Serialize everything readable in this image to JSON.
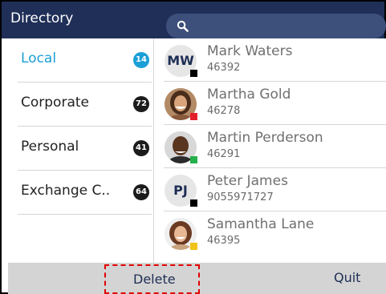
{
  "header": {
    "title": "Directory"
  },
  "search": {
    "icon": "search-icon",
    "value": ""
  },
  "sidebar": {
    "items": [
      {
        "label": "Local",
        "count": "14",
        "active": true
      },
      {
        "label": "Corporate",
        "count": "72",
        "active": false
      },
      {
        "label": "Personal",
        "count": "41",
        "active": false
      },
      {
        "label": "Exchange C..",
        "count": "64",
        "active": false
      }
    ]
  },
  "contacts": [
    {
      "initials": "MW",
      "name": "Mark Waters",
      "ext": "46392",
      "status_color": "#000000",
      "avatar": "initials-avatar"
    },
    {
      "initials": "",
      "name": "Martha Gold",
      "ext": "46278",
      "status_color": "#e3202a",
      "avatar": "photo-avatar"
    },
    {
      "initials": "",
      "name": "Martin Perderson",
      "ext": "46291",
      "status_color": "#24b04a",
      "avatar": "photo-avatar"
    },
    {
      "initials": "PJ",
      "name": "Peter James",
      "ext": "9055971727",
      "status_color": "#000000",
      "avatar": "initials-avatar"
    },
    {
      "initials": "",
      "name": "Samantha Lane",
      "ext": "46395",
      "status_color": "#f2c316",
      "avatar": "photo-avatar"
    }
  ],
  "softkeys": {
    "delete_label": "Delete",
    "quit_label": "Quit"
  },
  "colors": {
    "header_bg": "#1f2f57",
    "accent": "#1a9fd6",
    "softkey_bg": "#d4d4d4",
    "highlight_border": "#e00000"
  }
}
